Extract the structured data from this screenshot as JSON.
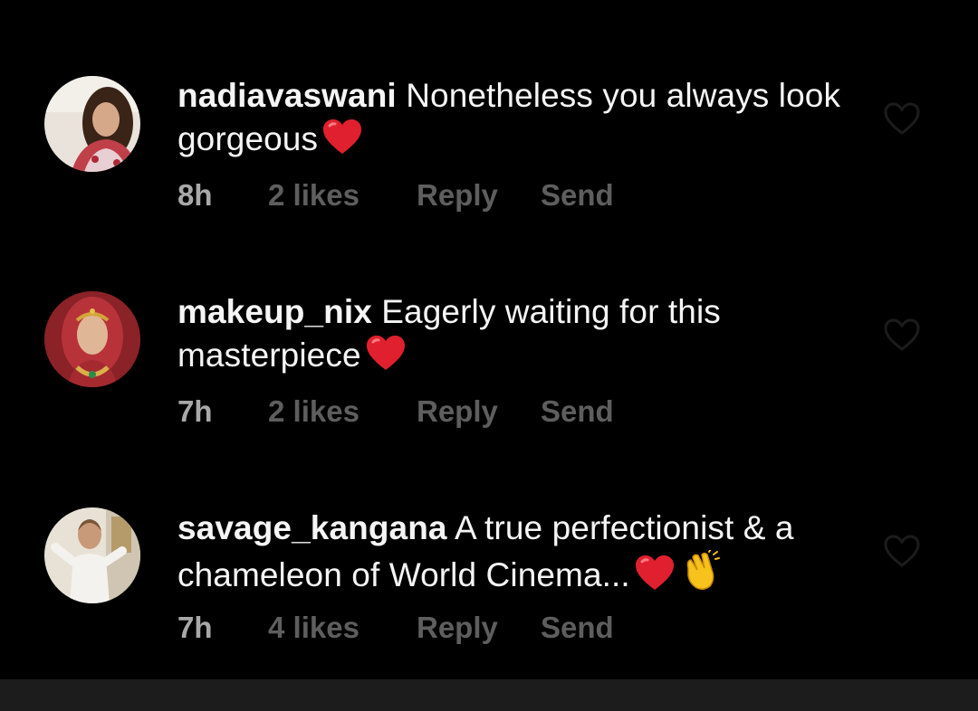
{
  "comments": [
    {
      "username": "nadiavaswani",
      "text": "Nonetheless you always look gorgeous",
      "emojis": [
        "red-heart"
      ],
      "time": "8h",
      "likes": "2 likes",
      "reply": "Reply",
      "send": "Send"
    },
    {
      "username": "makeup_nix",
      "text": "Eagerly waiting for this masterpiece",
      "emojis": [
        "red-heart"
      ],
      "time": "7h",
      "likes": "2 likes",
      "reply": "Reply",
      "send": "Send"
    },
    {
      "username": "savage_kangana",
      "text": "A true perfectionist & a chameleon of World Cinema...",
      "emojis": [
        "red-heart",
        "clapping-hands"
      ],
      "time": "7h",
      "likes": "4 likes",
      "reply": "Reply",
      "send": "Send"
    }
  ],
  "icons": {
    "like": "heart-outline-icon",
    "red_heart_color": "#e0202e",
    "clap_color": "#f7c21b"
  },
  "colors": {
    "background": "#000000",
    "text_primary": "#f5f5f5",
    "text_time": "#a8a8a8",
    "text_secondary": "#5e5e5e",
    "bottom_bar": "#1c1c1c"
  }
}
